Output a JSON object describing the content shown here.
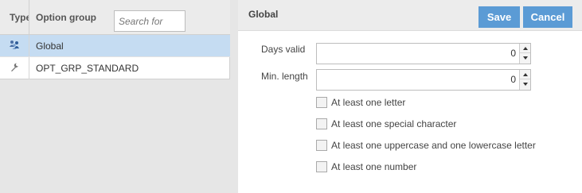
{
  "grid": {
    "columns": {
      "type": "Type",
      "group": "Option group"
    },
    "search": {
      "placeholder": "Search for",
      "value": ""
    },
    "rows": [
      {
        "icon": "people-group-icon",
        "label": "Global",
        "selected": true
      },
      {
        "icon": "wrench-icon",
        "label": "OPT_GRP_STANDARD",
        "selected": false
      }
    ]
  },
  "form": {
    "title": "Global",
    "save_label": "Save",
    "cancel_label": "Cancel",
    "fields": [
      {
        "label": "Days valid",
        "value": "0"
      },
      {
        "label": "Min. length",
        "value": "0"
      }
    ],
    "checkboxes": [
      {
        "label": "At least one letter",
        "checked": false
      },
      {
        "label": "At least one special character",
        "checked": false
      },
      {
        "label": "At least one uppercase and one lowercase letter",
        "checked": false
      },
      {
        "label": "At least one number",
        "checked": false
      }
    ]
  },
  "colors": {
    "accent": "#5b9bd5",
    "selection": "#c5dcf2",
    "panel_bg": "#e6e6e6"
  }
}
